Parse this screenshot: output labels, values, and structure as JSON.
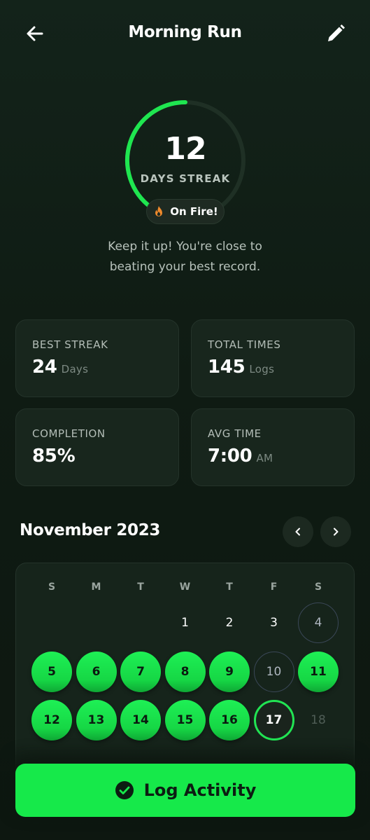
{
  "header": {
    "title": "Morning Run",
    "back_icon": "arrow-left-icon",
    "edit_icon": "pencil-icon"
  },
  "streak": {
    "count": "12",
    "label": "DAYS STREAK",
    "progress_fraction": 0.4,
    "badge_icon": "flame-icon",
    "badge_label": "On Fire!",
    "message_line1": "Keep it up! You're close to",
    "message_line2": "beating your best record."
  },
  "stats": {
    "best_streak": {
      "label": "BEST STREAK",
      "value": "24",
      "unit": "Days"
    },
    "total_times": {
      "label": "TOTAL TIMES",
      "value": "145",
      "unit": "Logs"
    },
    "completion": {
      "label": "COMPLETION",
      "value": "85%"
    },
    "avg_time": {
      "label": "AVG TIME",
      "value": "7:00",
      "unit": "AM"
    }
  },
  "calendar": {
    "month": "November 2023",
    "prev_icon": "chevron-left-icon",
    "next_icon": "chevron-right-icon",
    "weekdays": [
      "S",
      "M",
      "T",
      "W",
      "T",
      "F",
      "S"
    ],
    "days": [
      {
        "label": "1",
        "status": "plain"
      },
      {
        "label": "2",
        "status": "plain"
      },
      {
        "label": "3",
        "status": "plain"
      },
      {
        "label": "4",
        "status": "missed"
      },
      {
        "label": "5",
        "status": "done"
      },
      {
        "label": "6",
        "status": "done"
      },
      {
        "label": "7",
        "status": "done"
      },
      {
        "label": "8",
        "status": "done"
      },
      {
        "label": "9",
        "status": "done"
      },
      {
        "label": "10",
        "status": "missed"
      },
      {
        "label": "11",
        "status": "done"
      },
      {
        "label": "12",
        "status": "done"
      },
      {
        "label": "13",
        "status": "done"
      },
      {
        "label": "14",
        "status": "done"
      },
      {
        "label": "15",
        "status": "done"
      },
      {
        "label": "16",
        "status": "done"
      },
      {
        "label": "17",
        "status": "today"
      },
      {
        "label": "18",
        "status": "future"
      }
    ]
  },
  "colors": {
    "accent": "#16e94a",
    "background": "#0f1b13",
    "card": "#18261d",
    "flame": "#f08a2c"
  },
  "action": {
    "label": "Log Activity",
    "icon": "check-circle-icon"
  }
}
